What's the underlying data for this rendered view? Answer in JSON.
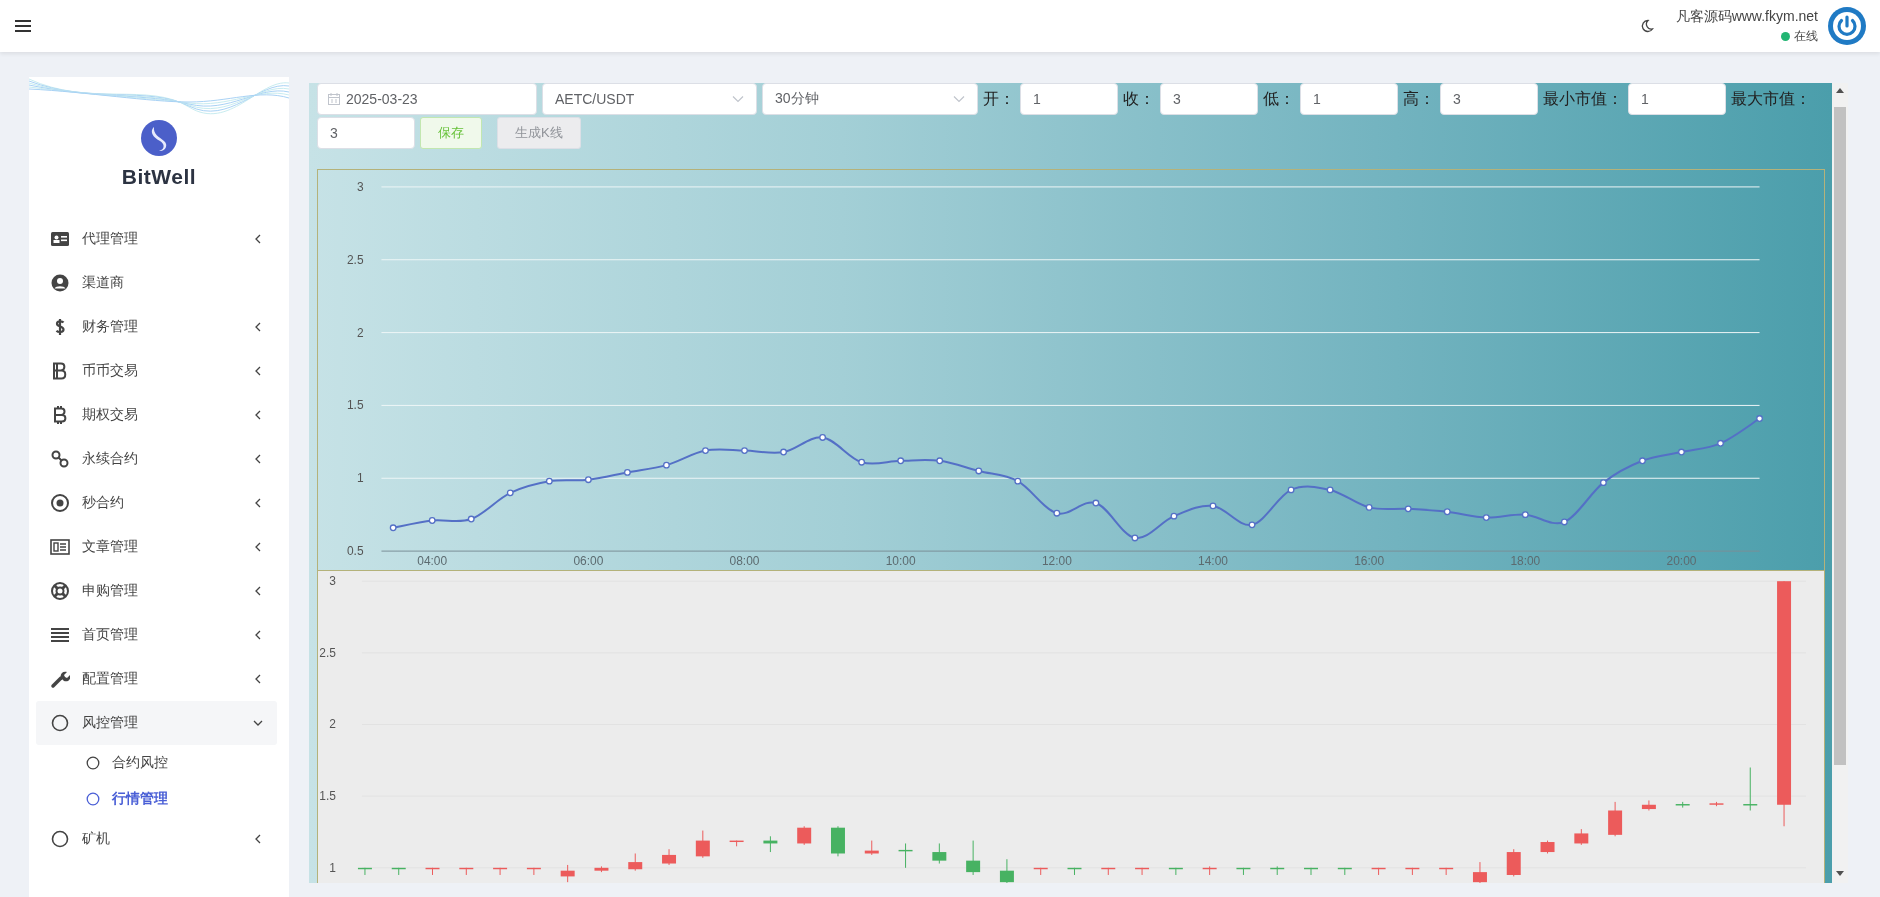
{
  "header": {
    "user_name": "凡客源码www.fkym.net",
    "status": {
      "label": "在线",
      "color": "#22b573"
    }
  },
  "sidebar": {
    "brand": "BitWell",
    "items": [
      {
        "label": "代理管理",
        "expandable": true,
        "expanded": false
      },
      {
        "label": "渠道商",
        "expandable": false
      },
      {
        "label": "财务管理",
        "expandable": true,
        "expanded": false
      },
      {
        "label": "币币交易",
        "expandable": true,
        "expanded": false
      },
      {
        "label": "期权交易",
        "expandable": true,
        "expanded": false
      },
      {
        "label": "永续合约",
        "expandable": true,
        "expanded": false
      },
      {
        "label": "秒合约",
        "expandable": true,
        "expanded": false
      },
      {
        "label": "文章管理",
        "expandable": true,
        "expanded": false
      },
      {
        "label": "申购管理",
        "expandable": true,
        "expanded": false
      },
      {
        "label": "首页管理",
        "expandable": true,
        "expanded": false
      },
      {
        "label": "配置管理",
        "expandable": true,
        "expanded": false
      },
      {
        "label": "风控管理",
        "expandable": true,
        "expanded": true,
        "children": [
          {
            "label": "合约风控",
            "selected": false
          },
          {
            "label": "行情管理",
            "selected": true
          }
        ]
      },
      {
        "label": "矿机",
        "expandable": true,
        "expanded": false
      }
    ]
  },
  "toolbar": {
    "date": "2025-03-23",
    "pair": "AETC/USDT",
    "interval": "30分钟",
    "fields": [
      {
        "label": "开：",
        "value": "1"
      },
      {
        "label": "收：",
        "value": "3"
      },
      {
        "label": "低：",
        "value": "1"
      },
      {
        "label": "高：",
        "value": "3"
      },
      {
        "label": "最小市值：",
        "value": "1"
      },
      {
        "label": "最大市值：",
        "value": "3"
      }
    ],
    "buttons": [
      {
        "label": "保存",
        "kind": "success"
      },
      {
        "label": "生成K线",
        "kind": "default"
      }
    ]
  },
  "line_chart": {
    "chart_data": {
      "type": "line",
      "x": [
        3.5,
        4,
        4.5,
        5,
        5.5,
        6,
        6.5,
        7,
        7.5,
        8,
        8.5,
        9,
        9.5,
        10,
        10.5,
        11,
        11.5,
        12,
        12.5,
        13,
        13.5,
        14,
        14.5,
        15,
        15.5,
        16,
        16.5,
        17,
        17.5,
        18,
        18.5,
        19,
        19.5,
        20,
        20.5,
        21
      ],
      "xlim": [
        3.35,
        21
      ],
      "grid": true,
      "series": [
        {
          "color": "#5470c6",
          "marker": "circle",
          "values": [
            0.66,
            0.71,
            0.72,
            0.9,
            0.98,
            0.99,
            1.04,
            1.09,
            1.19,
            1.19,
            1.18,
            1.28,
            1.11,
            1.12,
            1.12,
            1.05,
            0.98,
            0.76,
            0.83,
            0.59,
            0.74,
            0.81,
            0.68,
            0.92,
            0.92,
            0.8,
            0.79,
            0.77,
            0.73,
            0.75,
            0.7,
            0.97,
            1.12,
            1.18,
            1.24,
            1.41
          ]
        }
      ],
      "ylim": [
        0.5,
        3
      ],
      "yticks": [
        0.5,
        1,
        1.5,
        2,
        2.5,
        3
      ],
      "xticks": [
        {
          "value": 4,
          "label": "04:00"
        },
        {
          "value": 6,
          "label": "06:00"
        },
        {
          "value": 8,
          "label": "08:00"
        },
        {
          "value": 10,
          "label": "10:00"
        },
        {
          "value": 12,
          "label": "12:00"
        },
        {
          "value": 14,
          "label": "14:00"
        },
        {
          "value": 16,
          "label": "16:00"
        },
        {
          "value": 18,
          "label": "18:00"
        },
        {
          "value": 20,
          "label": "20:00"
        }
      ]
    }
  },
  "candle_chart": {
    "chart_data": {
      "type": "candlestick",
      "grid": true,
      "ylim": [
        1,
        3
      ],
      "yticks": [
        1,
        1.5,
        2,
        2.5,
        3
      ],
      "ohlc": [
        [
          1.0,
          1.0,
          0.95,
          0.99
        ],
        [
          1.0,
          1.0,
          0.95,
          0.99
        ],
        [
          0.99,
          1.0,
          0.95,
          1.0
        ],
        [
          0.99,
          1.0,
          0.95,
          1.0
        ],
        [
          0.99,
          1.0,
          0.95,
          1.0
        ],
        [
          0.99,
          1.0,
          0.95,
          1.0
        ],
        [
          0.94,
          1.02,
          0.9,
          0.98
        ],
        [
          0.98,
          1.01,
          0.97,
          1.0
        ],
        [
          0.99,
          1.1,
          0.98,
          1.04
        ],
        [
          1.03,
          1.13,
          1.02,
          1.09
        ],
        [
          1.08,
          1.26,
          1.07,
          1.19
        ],
        [
          1.18,
          1.19,
          1.15,
          1.19
        ],
        [
          1.19,
          1.22,
          1.11,
          1.17
        ],
        [
          1.17,
          1.29,
          1.16,
          1.28
        ],
        [
          1.28,
          1.29,
          1.08,
          1.1
        ],
        [
          1.1,
          1.19,
          1.09,
          1.12
        ],
        [
          1.125,
          1.17,
          1.0,
          1.115
        ],
        [
          1.11,
          1.17,
          1.03,
          1.05
        ],
        [
          1.05,
          1.19,
          0.95,
          0.97
        ],
        [
          0.98,
          1.06,
          0.88,
          0.9
        ],
        [
          0.99,
          1.0,
          0.95,
          1.0
        ],
        [
          1.0,
          1.0,
          0.95,
          0.99
        ],
        [
          0.99,
          1.0,
          0.95,
          1.0
        ],
        [
          0.99,
          1.0,
          0.95,
          1.0
        ],
        [
          1.0,
          1.0,
          0.95,
          0.99
        ],
        [
          0.99,
          1.01,
          0.95,
          1.0
        ],
        [
          1.0,
          1.0,
          0.95,
          0.99
        ],
        [
          1.0,
          1.01,
          0.95,
          0.99
        ],
        [
          1.0,
          1.0,
          0.95,
          0.99
        ],
        [
          1.0,
          1.0,
          0.95,
          0.99
        ],
        [
          0.99,
          1.0,
          0.95,
          1.0
        ],
        [
          0.99,
          1.0,
          0.95,
          1.0
        ],
        [
          0.99,
          1.0,
          0.95,
          1.0
        ],
        [
          0.9,
          1.04,
          0.88,
          0.97
        ],
        [
          0.95,
          1.13,
          0.94,
          1.11
        ],
        [
          1.11,
          1.19,
          1.1,
          1.18
        ],
        [
          1.17,
          1.27,
          1.16,
          1.24
        ],
        [
          1.23,
          1.46,
          1.22,
          1.4
        ],
        [
          1.41,
          1.47,
          1.4,
          1.44
        ],
        [
          1.445,
          1.46,
          1.42,
          1.435
        ],
        [
          1.44,
          1.46,
          1.43,
          1.45
        ],
        [
          1.445,
          1.7,
          1.4,
          1.435
        ],
        [
          1.44,
          3.0,
          1.29,
          3.0
        ]
      ]
    }
  }
}
